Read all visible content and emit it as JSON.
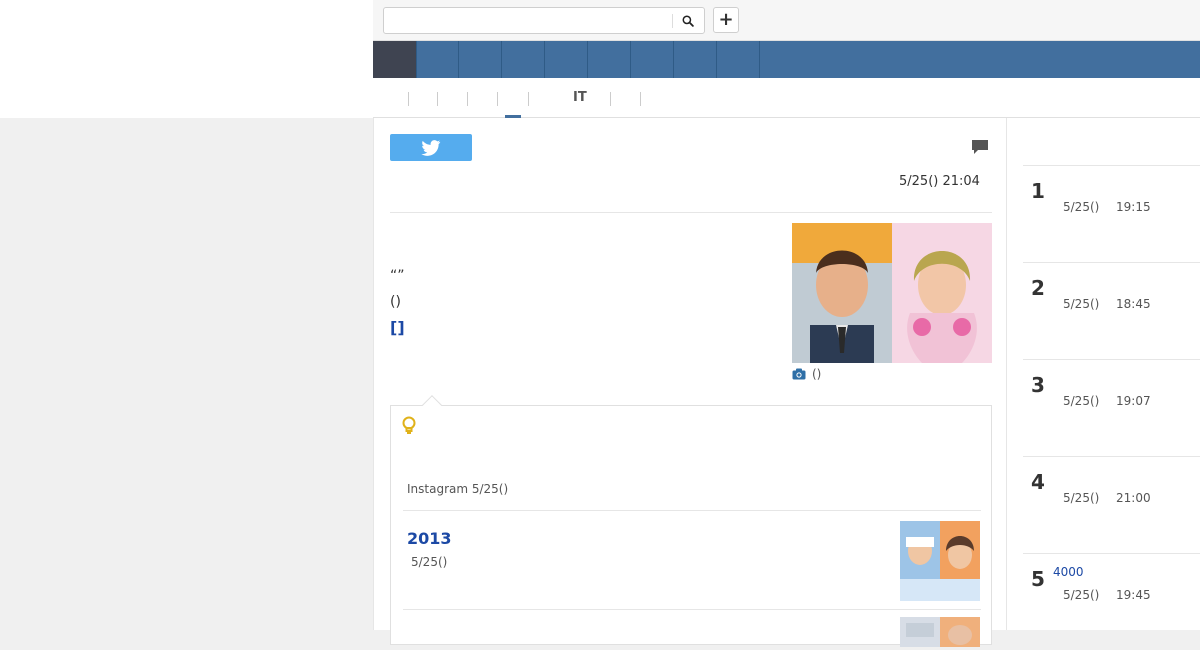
{
  "header": {
    "search_placeholder": "",
    "add_label": "+"
  },
  "subtabs": {
    "active_label": "IT"
  },
  "article": {
    "date": "5/25() 21:04",
    "text_lines": [
      "“”",
      "()",
      "[]"
    ],
    "photo_caption": "()"
  },
  "related": {
    "meta": "Instagram 5/25()",
    "title": "2013",
    "date": "5/25()"
  },
  "ranking": {
    "items": [
      {
        "num": "1",
        "title": "",
        "date": "5/25()",
        "time": "19:15"
      },
      {
        "num": "2",
        "title": "",
        "date": "5/25()",
        "time": "18:45"
      },
      {
        "num": "3",
        "title": "",
        "date": "5/25()",
        "time": "19:07"
      },
      {
        "num": "4",
        "title": "",
        "date": "5/25()",
        "time": "21:00"
      },
      {
        "num": "5",
        "title": "4000",
        "date": "5/25()",
        "time": "19:45"
      }
    ]
  },
  "colors": {
    "nav_blue": "#426f9e",
    "nav_home": "#3f4451",
    "twitter": "#55acee",
    "link_blue": "#1c49a5"
  }
}
